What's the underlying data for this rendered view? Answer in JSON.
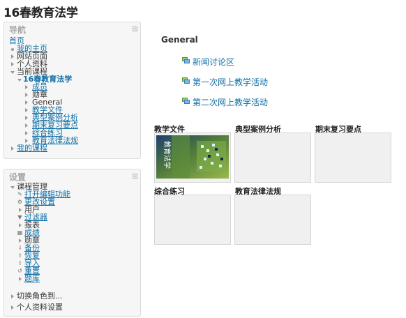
{
  "page": {
    "title": "16春教育法学"
  },
  "nav_block": {
    "title": "导航",
    "items": [
      {
        "label": "首页"
      },
      {
        "label": "我的主页"
      },
      {
        "label": "网站页面"
      },
      {
        "label": "个人资料"
      },
      {
        "label": "当前课程"
      },
      {
        "label": "16春教育法学"
      },
      {
        "label": "成员"
      },
      {
        "label": "勋章"
      },
      {
        "label": "General"
      },
      {
        "label": "教学文件"
      },
      {
        "label": "典型案例分析"
      },
      {
        "label": "期末复习要点"
      },
      {
        "label": "综合练习"
      },
      {
        "label": "教育法律法规"
      },
      {
        "label": "我的课程"
      }
    ]
  },
  "settings_block": {
    "title": "设置",
    "items": [
      {
        "label": "课程管理"
      },
      {
        "label": "打开编辑功能"
      },
      {
        "label": "更改设置"
      },
      {
        "label": "用户"
      },
      {
        "label": "过滤器"
      },
      {
        "label": "报表"
      },
      {
        "label": "成绩"
      },
      {
        "label": "勋章"
      },
      {
        "label": "备份"
      },
      {
        "label": "恢复"
      },
      {
        "label": "导入"
      },
      {
        "label": "重置"
      },
      {
        "label": "题库"
      },
      {
        "label": "切换角色到..."
      },
      {
        "label": "个人资料设置"
      }
    ]
  },
  "main": {
    "section_title": "General",
    "forums": [
      {
        "label": "新闻讨论区"
      },
      {
        "label": "第一次网上教学活动"
      },
      {
        "label": "第二次网上教学活动"
      }
    ],
    "tiles": [
      {
        "title": "教学文件"
      },
      {
        "title": "典型案例分析"
      },
      {
        "title": "期末复习要点"
      },
      {
        "title": "综合练习"
      },
      {
        "title": "教育法律法规"
      }
    ],
    "tile_image_text": "教育法学"
  },
  "colors": {
    "link": "#0e6fa6",
    "block_bg": "#f6f6f6",
    "tile_bg": "#f0f0f0"
  }
}
